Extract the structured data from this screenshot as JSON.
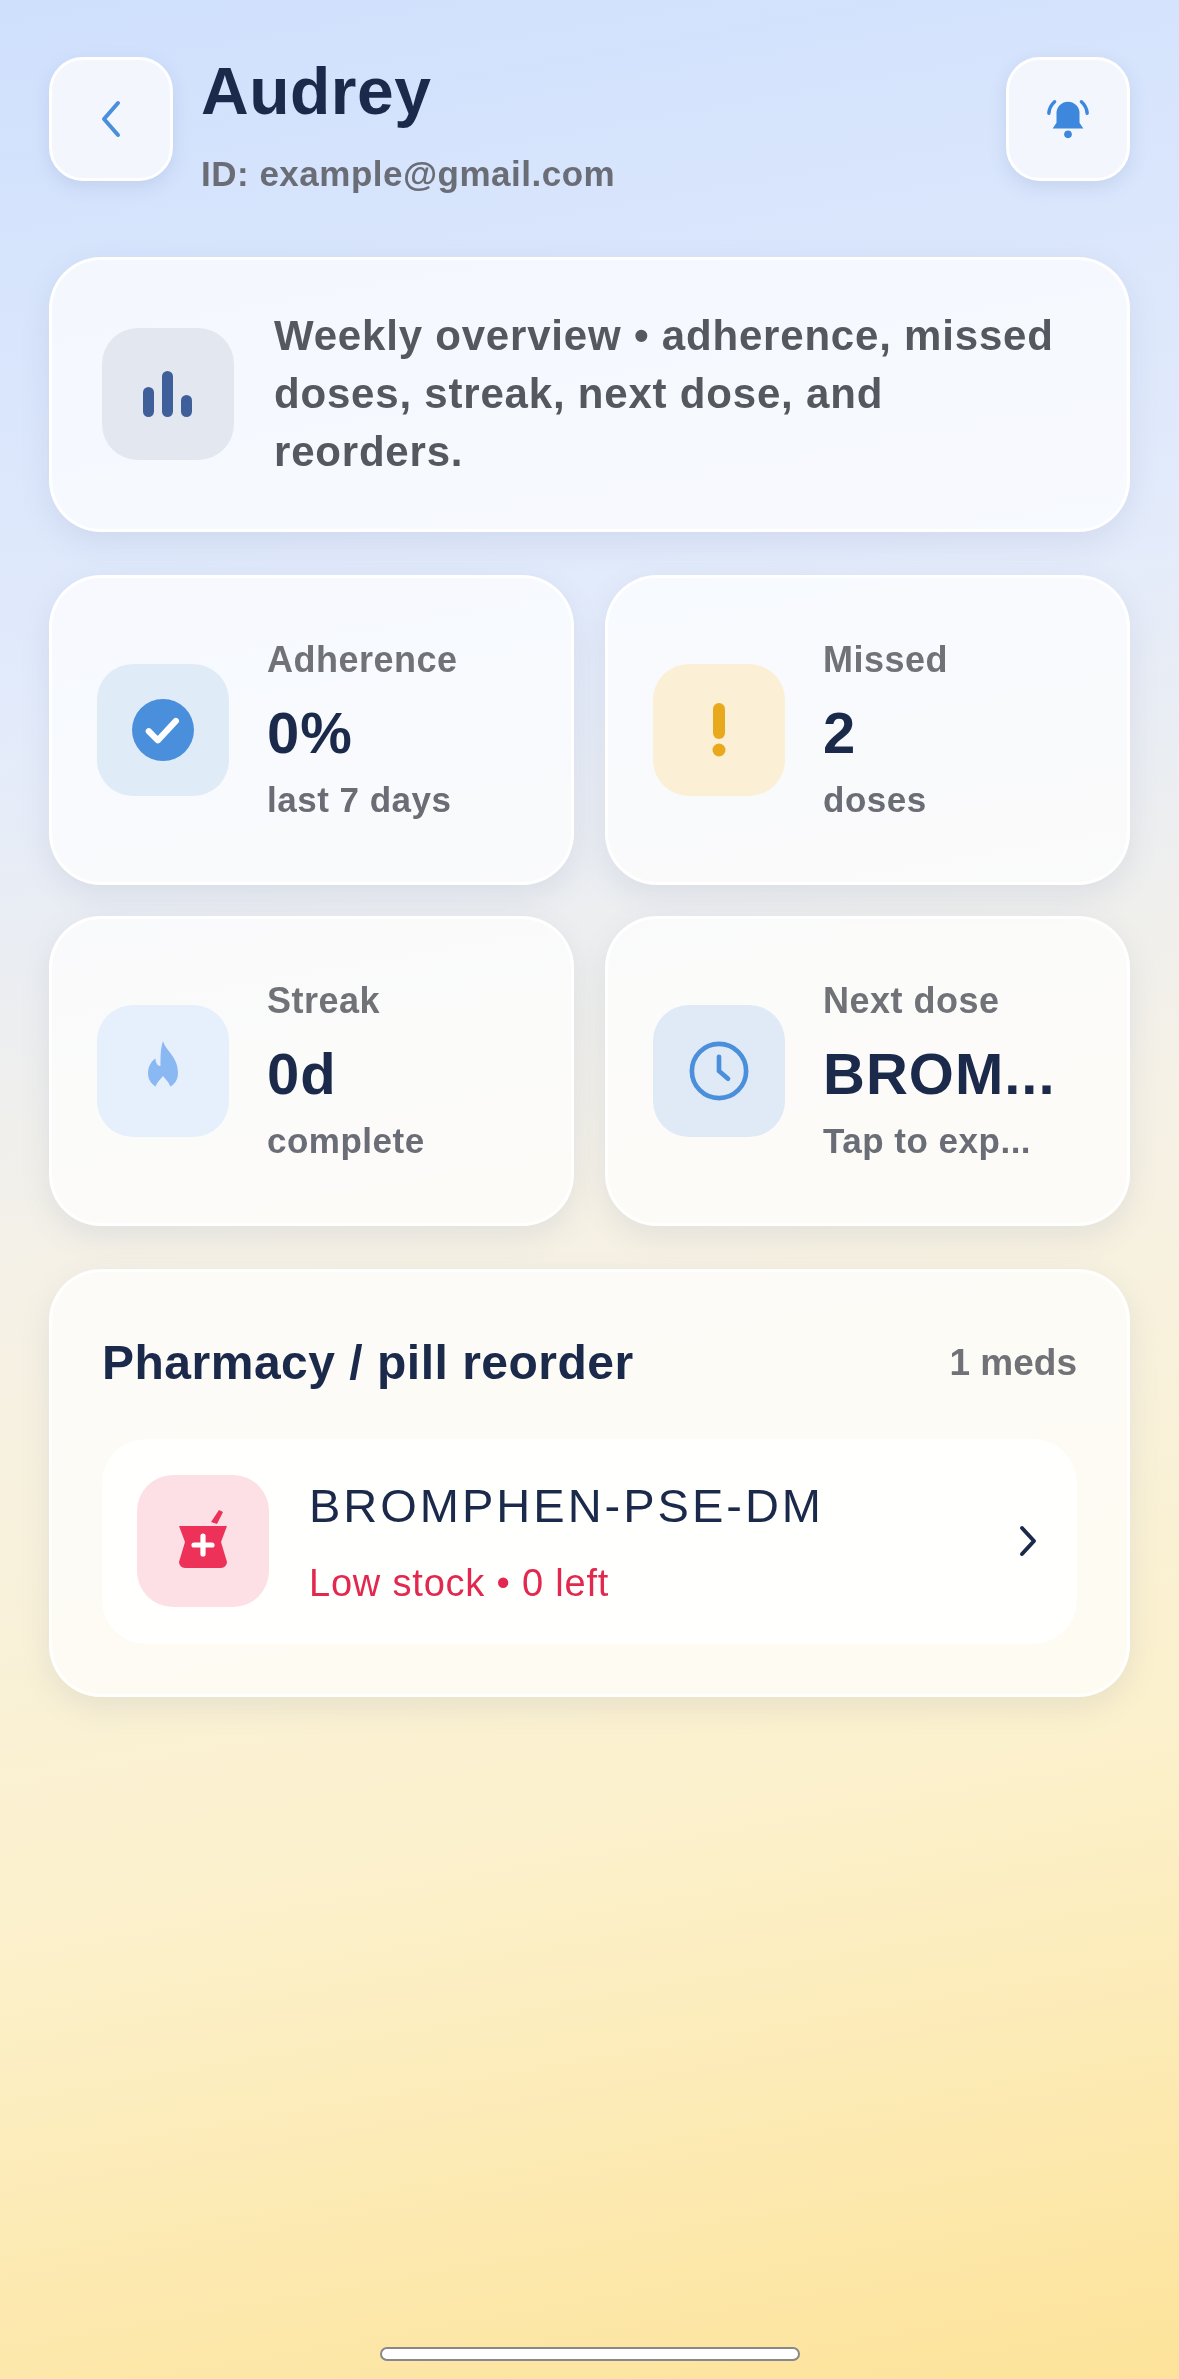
{
  "header": {
    "title": "Audrey",
    "subtitle": "ID: example@gmail.com"
  },
  "overview": {
    "text": "Weekly overview • adherence, missed doses, streak, next dose, and reorders."
  },
  "stats": [
    {
      "kind": "check",
      "label": "Adherence",
      "value": "0%",
      "note": "last 7 days"
    },
    {
      "kind": "alert",
      "label": "Missed",
      "value": "2",
      "note": "doses"
    },
    {
      "kind": "flame",
      "label": "Streak",
      "value": "0d",
      "note": "complete"
    },
    {
      "kind": "clock",
      "label": "Next dose",
      "value": "BROM...",
      "note": "Tap to exp..."
    }
  ],
  "pharmacy": {
    "title": "Pharmacy / pill reorder",
    "count": "1 meds",
    "items": [
      {
        "name": "BROMPHEN-PSE-DM",
        "status": "Low stock • 0 left"
      }
    ]
  }
}
